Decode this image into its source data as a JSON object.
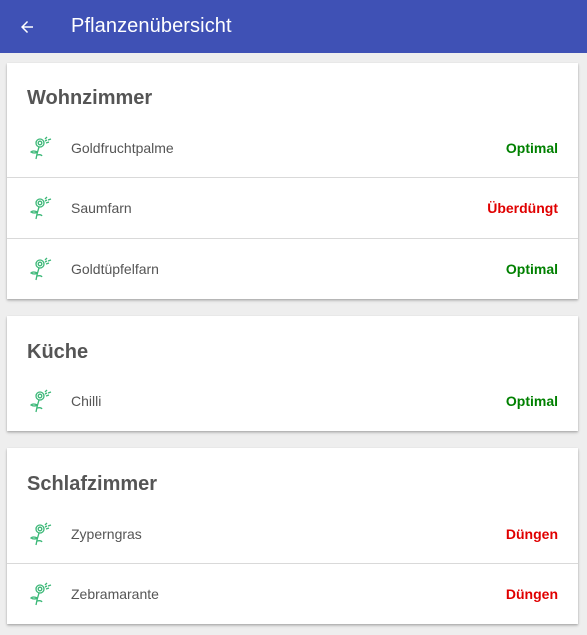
{
  "header": {
    "title": "Pflanzenübersicht",
    "back_icon": "arrow-left-icon",
    "background": "#3f51b5"
  },
  "rooms": [
    {
      "name": "Wohnzimmer",
      "plants": [
        {
          "name": "Goldfruchtpalme",
          "status": "Optimal",
          "status_color": "#008000",
          "icon": "plant-icon"
        },
        {
          "name": "Saumfarn",
          "status": "Überdüngt",
          "status_color": "#e00000",
          "icon": "plant-icon"
        },
        {
          "name": "Goldtüpfelfarn",
          "status": "Optimal",
          "status_color": "#008000",
          "icon": "plant-icon"
        }
      ]
    },
    {
      "name": "Küche",
      "plants": [
        {
          "name": "Chilli",
          "status": "Optimal",
          "status_color": "#008000",
          "icon": "plant-icon"
        }
      ]
    },
    {
      "name": "Schlafzimmer",
      "plants": [
        {
          "name": "Zyperngras",
          "status": "Düngen",
          "status_color": "#e00000",
          "icon": "plant-icon"
        },
        {
          "name": "Zebramarante",
          "status": "Düngen",
          "status_color": "#e00000",
          "icon": "plant-icon"
        }
      ]
    }
  ]
}
